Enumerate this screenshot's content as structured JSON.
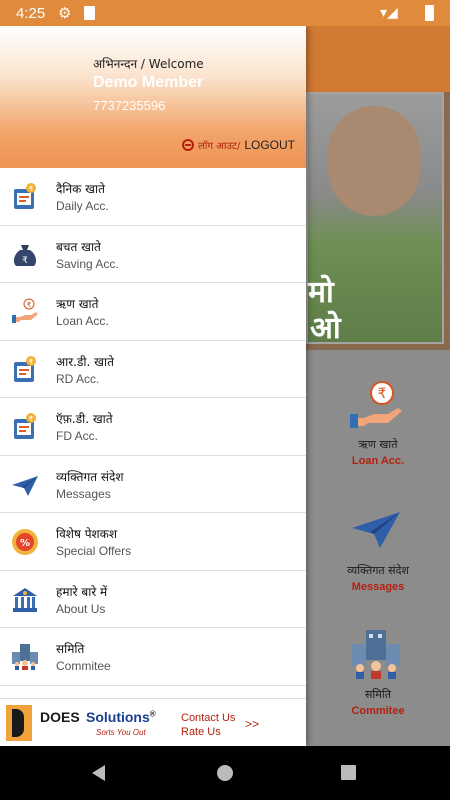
{
  "status_bar": {
    "time": "4:25",
    "icons": [
      "gear-icon",
      "sd-card-icon",
      "wifi-icon",
      "signal-icon",
      "battery-icon"
    ]
  },
  "drawer": {
    "welcome": "अभिनन्दन / Welcome",
    "member_name": "Demo Member",
    "phone": "7737235596",
    "logout_hi": "लॉग आउट/",
    "logout_en": "LOGOUT",
    "items": [
      {
        "hi": "दैनिक खाते",
        "en": "Daily Acc.",
        "icon": "daily-account-icon"
      },
      {
        "hi": "बचत खाते",
        "en": "Saving Acc.",
        "icon": "money-bag-icon"
      },
      {
        "hi": "ऋण खाते",
        "en": "Loan Acc.",
        "icon": "loan-hand-icon"
      },
      {
        "hi": "आर.डी. खाते",
        "en": "RD Acc.",
        "icon": "rd-account-icon"
      },
      {
        "hi": "ऍफ़.डी. खाते",
        "en": "FD Acc.",
        "icon": "fd-account-icon"
      },
      {
        "hi": "व्यक्तिगत संदेश",
        "en": "Messages",
        "icon": "paper-plane-icon"
      },
      {
        "hi": "विशेष पेशकश",
        "en": "Special Offers",
        "icon": "offer-badge-icon"
      },
      {
        "hi": "हमारे बारे में",
        "en": "About Us",
        "icon": "bank-building-icon"
      },
      {
        "hi": "समिति",
        "en": "Commitee",
        "icon": "committee-building-icon"
      }
    ]
  },
  "ad": {
    "brand_does": "DOES",
    "brand_solutions": "Solutions",
    "registered": "®",
    "tagline": "Sorts You Out",
    "contact": "Contact Us",
    "rate": "Rate Us",
    "arrow": ">>"
  },
  "background": {
    "banner_text_1": "मो",
    "banner_text_2": "ओ",
    "tiles": [
      {
        "hi": "ऋण खाते",
        "en": "Loan Acc."
      },
      {
        "hi": "व्यक्तिगत संदेश",
        "en": "Messages"
      },
      {
        "hi": "समिति",
        "en": "Commitee"
      }
    ]
  },
  "colors": {
    "accent_orange": "#e08a3c",
    "brand_red": "#b3210e",
    "brand_blue": "#1b3f8f"
  }
}
